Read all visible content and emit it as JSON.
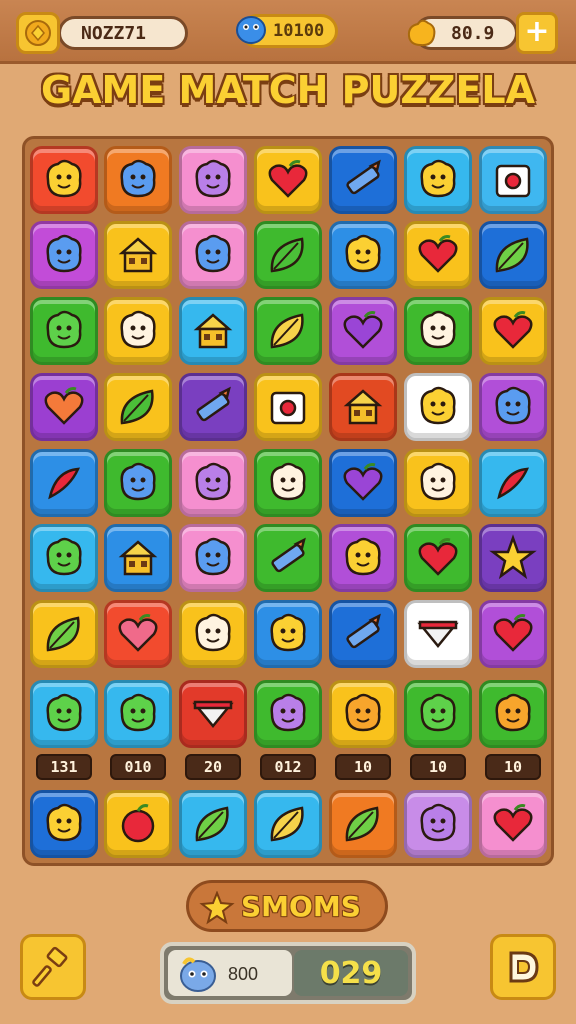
{
  "header": {
    "left_value": "NOZZ71",
    "mid_value": "10100",
    "right_value": "80.9",
    "plus_label": "+"
  },
  "title": "GAME MATCH PUZZELA",
  "board": {
    "rows": [
      [
        {
          "color": "#f24b2e",
          "icon": "smile-blob-icon"
        },
        {
          "color": "#f07a22",
          "icon": "blue-bird-icon"
        },
        {
          "color": "#f58fcf",
          "icon": "pink-fish-icon"
        },
        {
          "color": "#f9c21c",
          "icon": "heart-icon"
        },
        {
          "color": "#1e6fd8",
          "icon": "trumpet-icon"
        },
        {
          "color": "#36b8ee",
          "icon": "yellow-flower-icon"
        },
        {
          "color": "#3fb7f0",
          "icon": "jar-icon"
        }
      ],
      [
        {
          "color": "#c24cd8",
          "icon": "blue-blob-icon"
        },
        {
          "color": "#f9c21c",
          "icon": "basket-icon"
        },
        {
          "color": "#f58fcf",
          "icon": "blue-puzzle-icon"
        },
        {
          "color": "#3fba2e",
          "icon": "kite-icon"
        },
        {
          "color": "#2d8fe6",
          "icon": "bugs-icon"
        },
        {
          "color": "#f9c21c",
          "icon": "heart-icon"
        },
        {
          "color": "#1e6fd8",
          "icon": "pear-icon"
        }
      ],
      [
        {
          "color": "#3fba2e",
          "icon": "green-smile-icon"
        },
        {
          "color": "#f9c21c",
          "icon": "cloud-icon"
        },
        {
          "color": "#36b8ee",
          "icon": "house-icon"
        },
        {
          "color": "#3fba2e",
          "icon": "lemon-icon"
        },
        {
          "color": "#b14fd8",
          "icon": "purple-heart-icon"
        },
        {
          "color": "#3fba2e",
          "icon": "white-cube-icon"
        },
        {
          "color": "#f9c21c",
          "icon": "heart-icon"
        }
      ],
      [
        {
          "color": "#9b3fd1",
          "icon": "orange-heart-icon"
        },
        {
          "color": "#f9c21c",
          "icon": "leaf-icon"
        },
        {
          "color": "#7a3fc0",
          "icon": "pencil-icon"
        },
        {
          "color": "#f9c21c",
          "icon": "camera-icon"
        },
        {
          "color": "#e24a22",
          "icon": "house-icon"
        },
        {
          "color": "#ffffff",
          "icon": "cheese-icon"
        },
        {
          "color": "#b14fd8",
          "icon": "blue-drop-icon"
        }
      ],
      [
        {
          "color": "#2d8fe6",
          "icon": "red-chili-icon"
        },
        {
          "color": "#3fba2e",
          "icon": "blue-fish-icon"
        },
        {
          "color": "#f58fcf",
          "icon": "purple-fish-icon"
        },
        {
          "color": "#3fba2e",
          "icon": "cream-blob-icon"
        },
        {
          "color": "#1e6fd8",
          "icon": "purple-heart-icon"
        },
        {
          "color": "#f9c21c",
          "icon": "cloud-icon"
        },
        {
          "color": "#36b8ee",
          "icon": "chili-icon"
        }
      ],
      [
        {
          "color": "#36b8ee",
          "icon": "green-flower-icon"
        },
        {
          "color": "#2d8fe6",
          "icon": "house-icon"
        },
        {
          "color": "#f58fcf",
          "icon": "blue-blob-icon"
        },
        {
          "color": "#3fba2e",
          "icon": "bell-icon"
        },
        {
          "color": "#b14fd8",
          "icon": "yellow-bird-icon"
        },
        {
          "color": "#3fba2e",
          "icon": "heart-icon"
        },
        {
          "color": "#7a3fc0",
          "icon": "star-icon"
        }
      ],
      [
        {
          "color": "#f9c21c",
          "icon": "green-leaf-icon"
        },
        {
          "color": "#f24b2e",
          "icon": "pink-heart-icon"
        },
        {
          "color": "#f9c21c",
          "icon": "white-cloud-icon"
        },
        {
          "color": "#2d8fe6",
          "icon": "cheese-icon"
        },
        {
          "color": "#1e6fd8",
          "icon": "pencil-icon"
        },
        {
          "color": "#ffffff",
          "icon": "flag-icon"
        },
        {
          "color": "#b14fd8",
          "icon": "heart-icon"
        }
      ],
      [
        {
          "color": "#36b8ee",
          "icon": "green-smile-icon"
        },
        {
          "color": "#36b8ee",
          "icon": "green-blob-icon"
        },
        {
          "color": "#e23a2a",
          "icon": "cup-icon"
        },
        {
          "color": "#3fba2e",
          "icon": "purple-ball-icon"
        },
        {
          "color": "#f9c21c",
          "icon": "orange-flower-icon"
        },
        {
          "color": "#3fba2e",
          "icon": "green-smile-icon"
        },
        {
          "color": "#3fba2e",
          "icon": "orange-flower-icon"
        }
      ],
      [
        {
          "color": "#1e6fd8",
          "icon": "cheese-icon"
        },
        {
          "color": "#f9c21c",
          "icon": "apple-icon"
        },
        {
          "color": "#36b8ee",
          "icon": "green-leaf-icon"
        },
        {
          "color": "#36b8ee",
          "icon": "lemon-icon"
        },
        {
          "color": "#f07a22",
          "icon": "green-lemon-icon"
        },
        {
          "color": "#c88ce8",
          "icon": "purple-fish-icon"
        },
        {
          "color": "#f58fcf",
          "icon": "heart-icon"
        }
      ]
    ],
    "score_tags": [
      "131",
      "010",
      "20",
      "012",
      "10",
      "10",
      "10"
    ]
  },
  "bonus_label": "SMOMS",
  "score": {
    "label": "800",
    "value": "029"
  }
}
